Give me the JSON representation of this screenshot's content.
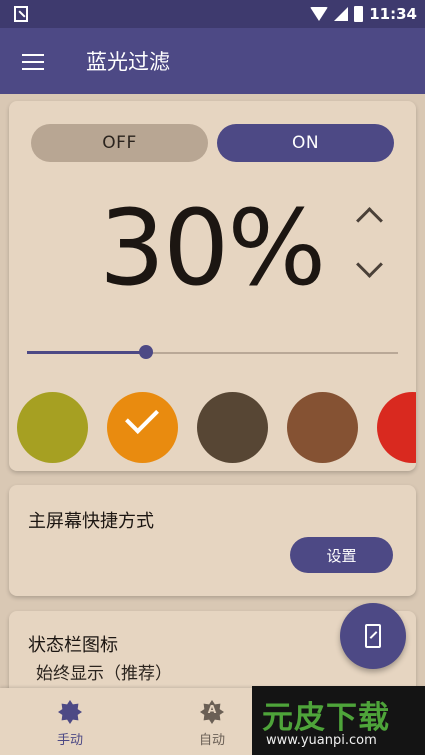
{
  "status_bar": {
    "time": "11:34"
  },
  "app_bar": {
    "title": "蓝光过滤"
  },
  "filter": {
    "off_label": "OFF",
    "on_label": "ON",
    "active": "ON",
    "intensity_text": "30%",
    "intensity_value": 0.32,
    "colors": [
      "#a6a022",
      "#e98b0f",
      "#574634",
      "#855233",
      "#d9291f"
    ],
    "selected_color_index": 1
  },
  "shortcut_card": {
    "title": "主屏幕快捷方式",
    "button_label": "设置"
  },
  "status_card": {
    "title": "状态栏图标",
    "subtitle": "始终显示（推荐）"
  },
  "bottom_nav": {
    "manual_label": "手动",
    "auto_label": "自动",
    "auto_icon_letter": "A"
  },
  "watermark": {
    "title": "元皮下载",
    "url": "www.yuanpi.com"
  }
}
